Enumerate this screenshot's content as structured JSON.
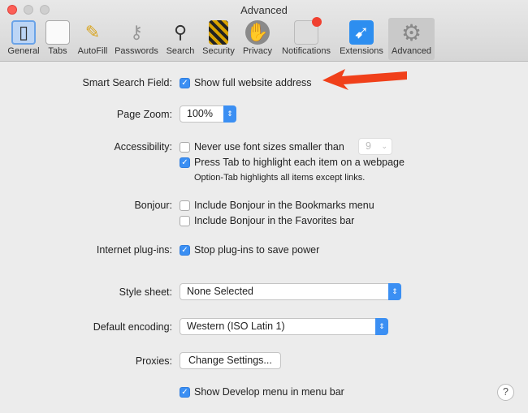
{
  "window": {
    "title": "Advanced"
  },
  "toolbar": [
    {
      "label": "General",
      "icon": "general-switch-icon"
    },
    {
      "label": "Tabs",
      "icon": "tabs-icon"
    },
    {
      "label": "AutoFill",
      "icon": "pencil-icon"
    },
    {
      "label": "Passwords",
      "icon": "key-icon"
    },
    {
      "label": "Search",
      "icon": "magnifier-icon"
    },
    {
      "label": "Security",
      "icon": "padlock-icon"
    },
    {
      "label": "Privacy",
      "icon": "hand-icon"
    },
    {
      "label": "Notifications",
      "icon": "notification-badge-icon"
    },
    {
      "label": "Extensions",
      "icon": "puzzle-compass-icon"
    },
    {
      "label": "Advanced",
      "icon": "gear-icon",
      "selected": true
    }
  ],
  "settings": {
    "smart_search_label": "Smart Search Field:",
    "show_full_address": "Show full website address",
    "page_zoom_label": "Page Zoom:",
    "page_zoom_value": "100%",
    "accessibility_label": "Accessibility:",
    "min_font": "Never use font sizes smaller than",
    "min_font_value": "9",
    "press_tab": "Press Tab to highlight each item on a webpage",
    "option_tab_note": "Option-Tab highlights all items except links.",
    "bonjour_label": "Bonjour:",
    "bonjour_bookmarks": "Include Bonjour in the Bookmarks menu",
    "bonjour_favorites": "Include Bonjour in the Favorites bar",
    "plugins_label": "Internet plug-ins:",
    "stop_plugins": "Stop plug-ins to save power",
    "stylesheet_label": "Style sheet:",
    "stylesheet_value": "None Selected",
    "encoding_label": "Default encoding:",
    "encoding_value": "Western (ISO Latin 1)",
    "proxies_label": "Proxies:",
    "change_settings": "Change Settings...",
    "develop_menu": "Show Develop menu in menu bar",
    "help": "?"
  },
  "colors": {
    "accent": "#3b8ff3",
    "arrow": "#f0401a"
  }
}
